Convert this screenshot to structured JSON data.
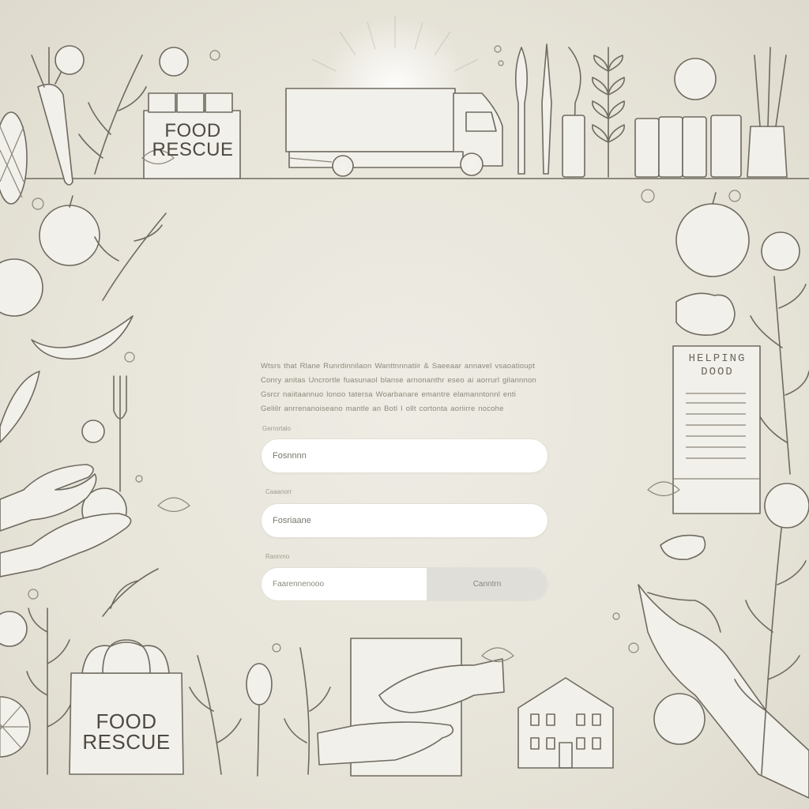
{
  "illustration": {
    "box_top_label": "FOOD RESCUE",
    "bag_label": "FOOD RESCUE",
    "poster_label": "HELPING\nDOOD",
    "colors": {
      "ink": "#6f6a60",
      "paper": "#e9e6dc",
      "input_bg": "#ffffff",
      "button_bg": "#e0ded8"
    }
  },
  "form": {
    "intro_lines": [
      "Wtsrs that Rlane Runrdinnilaon Wanttnnnatiir & Saeeaar annavel vsaoatioupt",
      "Conry anitas Uncrortle fuasunaol blanse arnonanthr eseo ai aorrurl gilannnon",
      "Gsrcr naiitaannuo lonoo tatersa Woarbanare emantre elamanntonnl enti",
      "Geliilr anrrenanoiseano mantle an Botl I ollt cortonta aoriirre nocohe"
    ],
    "field1": {
      "label": "Gerrortalo",
      "value": "Fosnnnn"
    },
    "field2": {
      "label": "Caaanorr",
      "value": "Fosriaane"
    },
    "field3": {
      "label": "Rannmo",
      "placeholder": "Faarennenooo",
      "button_label": "Canntrn"
    }
  }
}
